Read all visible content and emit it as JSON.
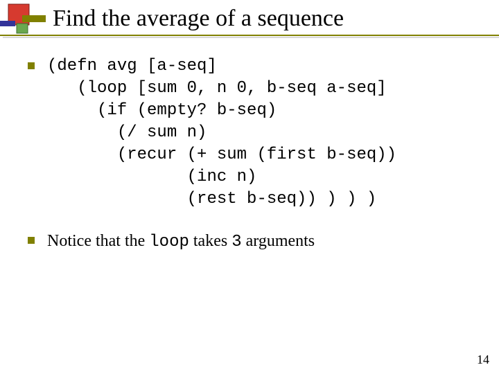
{
  "title": "Find the average of a sequence",
  "code": {
    "l1": "(defn avg [a-seq]",
    "l2": "   (loop [sum 0, n 0, b-seq a-seq]",
    "l3": "     (if (empty? b-seq)",
    "l4": "       (/ sum n)",
    "l5": "       (recur (+ sum (first b-seq))",
    "l6": "              (inc n)",
    "l7": "              (rest b-seq)) ) ) )"
  },
  "note": {
    "prefix": "Notice that the ",
    "loop_word": "loop",
    "mid": " takes ",
    "three_word": "3",
    "suffix": " arguments"
  },
  "page_number": "14",
  "colors": {
    "accent": "#808000"
  }
}
